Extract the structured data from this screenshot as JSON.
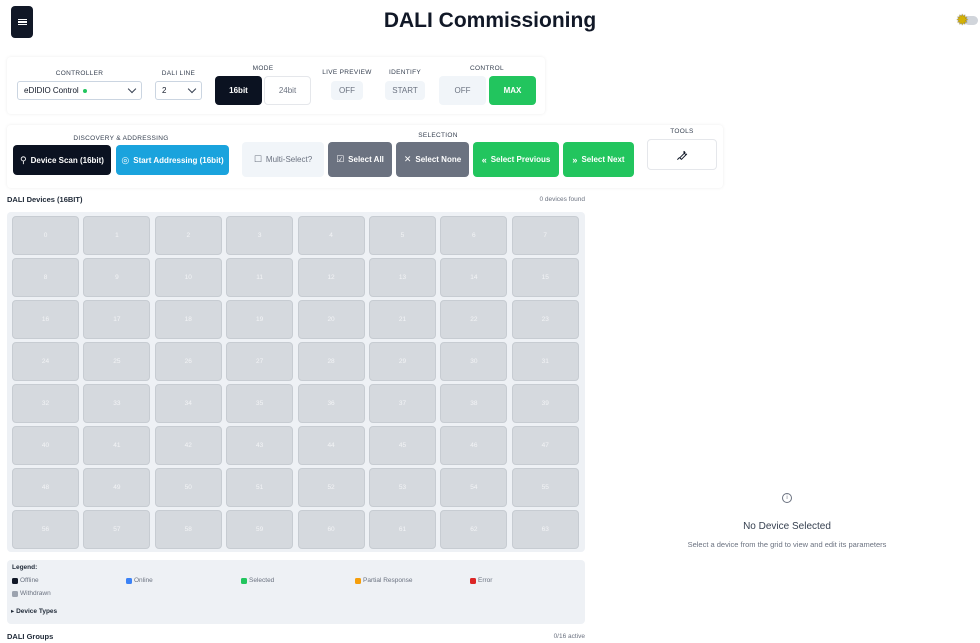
{
  "header": {
    "title": "DALI Commissioning",
    "menu_icon": "hamburger-icon",
    "theme_icon": "sun-icon"
  },
  "controls": {
    "controller": {
      "label": "CONTROLLER",
      "value": "eDIDIO Control",
      "status_color": "#22c55e"
    },
    "dali_line": {
      "label": "DALI LINE",
      "value": "2"
    },
    "mode": {
      "label": "MODE",
      "options": [
        "16bit",
        "24bit"
      ],
      "selected": "16bit"
    },
    "live_preview": {
      "label": "LIVE PREVIEW",
      "value": "OFF"
    },
    "identify": {
      "label": "IDENTIFY",
      "value": "START"
    },
    "control": {
      "label": "CONTROL",
      "off": "OFF",
      "max": "MAX"
    }
  },
  "discovery": {
    "label": "DISCOVERY & ADDRESSING",
    "scan": "Device Scan (16bit)",
    "address": "Start Addressing (16bit)"
  },
  "selection": {
    "label": "SELECTION",
    "multi": "Multi-Select?",
    "all": "Select All",
    "none": "Select None",
    "prev": "Select Previous",
    "next": "Select Next"
  },
  "tools": {
    "label": "TOOLS",
    "icon": "wrench-icon"
  },
  "devices": {
    "title": "DALI Devices (16BIT)",
    "count": "0 devices found",
    "addresses": [
      "0",
      "1",
      "2",
      "3",
      "4",
      "5",
      "6",
      "7",
      "8",
      "9",
      "10",
      "11",
      "12",
      "13",
      "14",
      "15",
      "16",
      "17",
      "18",
      "19",
      "20",
      "21",
      "22",
      "23",
      "24",
      "25",
      "26",
      "27",
      "28",
      "29",
      "30",
      "31",
      "32",
      "33",
      "34",
      "35",
      "36",
      "37",
      "38",
      "39",
      "40",
      "41",
      "42",
      "43",
      "44",
      "45",
      "46",
      "47",
      "48",
      "49",
      "50",
      "51",
      "52",
      "53",
      "54",
      "55",
      "56",
      "57",
      "58",
      "59",
      "60",
      "61",
      "62",
      "63"
    ]
  },
  "legend": {
    "title": "Legend:",
    "items": [
      {
        "label": "Offline",
        "color": "#111827"
      },
      {
        "label": "Online",
        "color": "#3b82f6"
      },
      {
        "label": "Selected",
        "color": "#22c55e"
      },
      {
        "label": "Partial Response",
        "color": "#f59e0b"
      },
      {
        "label": "Error",
        "color": "#dc2626"
      },
      {
        "label": "Withdrawn",
        "color": "#9ca3af"
      }
    ],
    "device_types": "▸ Device Types"
  },
  "groups": {
    "title": "DALI Groups",
    "count": "0/16 active"
  },
  "detail": {
    "title": "No Device Selected",
    "subtitle": "Select a device from the grid to view and edit its parameters"
  }
}
